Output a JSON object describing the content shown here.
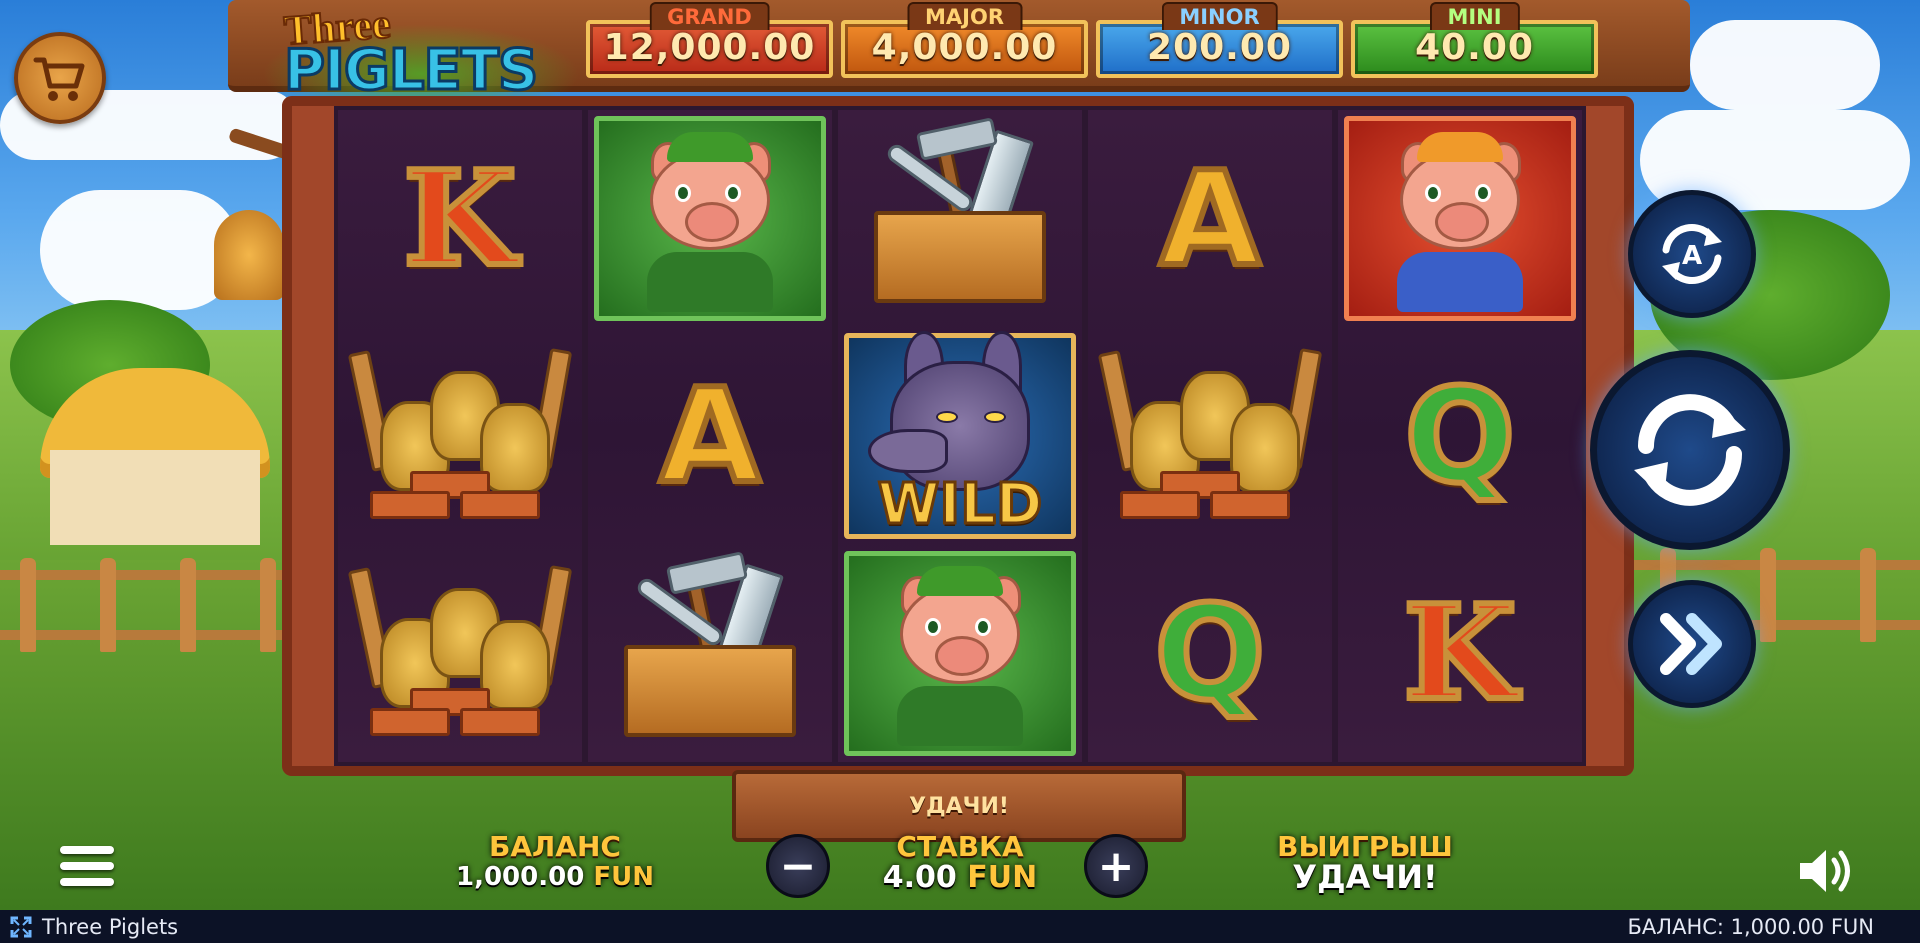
{
  "game": {
    "name": "Three Piglets"
  },
  "logo": {
    "line1": "Three",
    "line2": "PIGLETS"
  },
  "jackpots": [
    {
      "name": "GRAND",
      "value": "12,000.00"
    },
    {
      "name": "MAJOR",
      "value": "4,000.00"
    },
    {
      "name": "MINOR",
      "value": "200.00"
    },
    {
      "name": "MINI",
      "value": "40.00"
    }
  ],
  "reels": [
    [
      "K",
      "hay-bricks",
      "hay-bricks"
    ],
    [
      "pig-green",
      "A",
      "toolbox"
    ],
    [
      "toolbox",
      "wolf-wild",
      "pig-green"
    ],
    [
      "A",
      "hay-bricks",
      "Q"
    ],
    [
      "pig-red",
      "Q",
      "K"
    ]
  ],
  "symbols": {
    "wild_text": "WILD",
    "k": "K",
    "a": "A",
    "q": "Q"
  },
  "board": {
    "message": "УДАЧИ!"
  },
  "balance": {
    "label": "БАЛАНС",
    "amount": "1,000.00",
    "currency": "FUN"
  },
  "bet": {
    "label": "СТАВКА",
    "amount": "4.00",
    "currency": "FUN",
    "decrease": "−",
    "increase": "+"
  },
  "win": {
    "label": "ВЫИГРЫШ",
    "value": "УДАЧИ!"
  },
  "footer": {
    "title": "Three Piglets",
    "balance": "БАЛАНС: 1,000.00 FUN"
  },
  "icons": {
    "cart": "shopping-cart-icon",
    "autoplay": "autoplay-icon",
    "spin": "spin-icon",
    "turbo": "fast-forward-icon",
    "menu": "hamburger-menu-icon",
    "sound": "speaker-icon",
    "fullscreen": "fullscreen-icon"
  },
  "colors": {
    "grand": "#b82a18",
    "major": "#c0560e",
    "minor": "#1f6ec8",
    "mini": "#2c8a1c",
    "label_gold": "#ffc53c"
  }
}
